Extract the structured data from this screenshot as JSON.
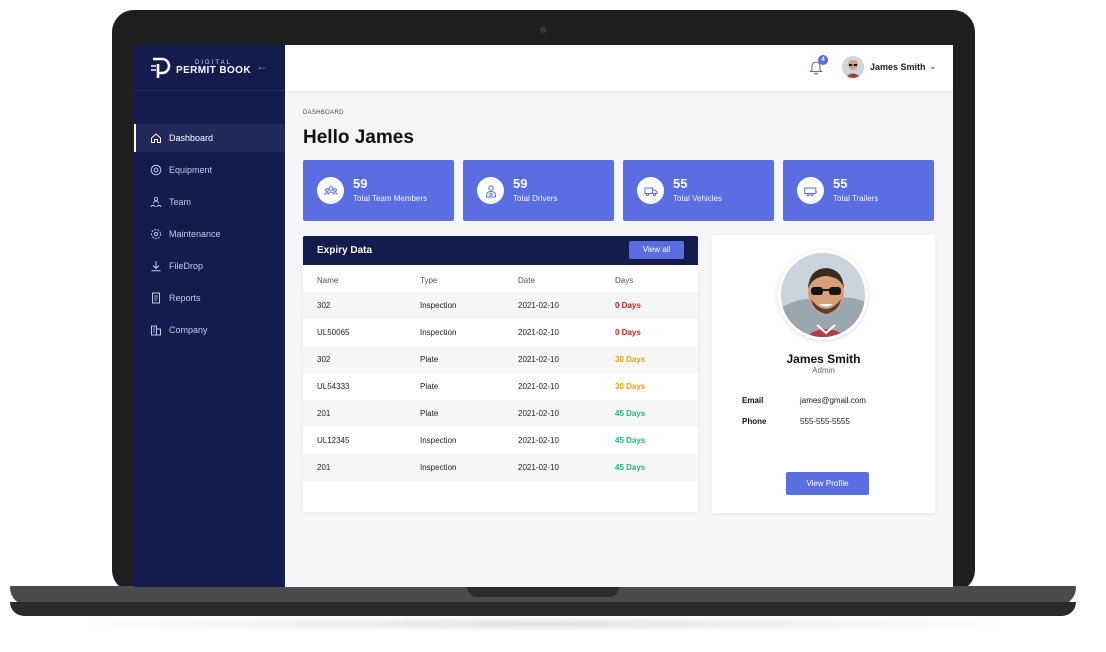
{
  "colors": {
    "sidebar_bg": "#141b4d",
    "accent": "#5b6ee1",
    "days_red": "#d71f1f",
    "days_orange": "#f0a30a",
    "days_green": "#22b97a"
  },
  "sidebar": {
    "logo": {
      "top": "DIGITAL",
      "main": "PERMIT BOOK"
    },
    "collapse_icon": "arrow-left-icon",
    "items": [
      {
        "label": "Dashboard",
        "icon": "home-icon",
        "active": true
      },
      {
        "label": "Equipment",
        "icon": "gear-circle-icon",
        "active": false
      },
      {
        "label": "Team",
        "icon": "team-icon",
        "active": false
      },
      {
        "label": "Maintenance",
        "icon": "maintenance-icon",
        "active": false
      },
      {
        "label": "FileDrop",
        "icon": "download-icon",
        "active": false
      },
      {
        "label": "Reports",
        "icon": "report-icon",
        "active": false
      },
      {
        "label": "Company",
        "icon": "building-icon",
        "active": false
      }
    ]
  },
  "topbar": {
    "notification_count": "4",
    "user_name": "James Smith",
    "chevron": "⌄"
  },
  "main": {
    "breadcrumb": "DASHBOARD",
    "greeting": "Hello James",
    "stats": [
      {
        "value": "59",
        "label": "Total Team Members",
        "icon": "team-icon"
      },
      {
        "value": "59",
        "label": "Total Drivers",
        "icon": "driver-icon"
      },
      {
        "value": "55",
        "label": "Total Vehicles",
        "icon": "truck-icon"
      },
      {
        "value": "55",
        "label": "Total Trailers",
        "icon": "trailer-icon"
      }
    ],
    "expiry": {
      "title": "Expiry Data",
      "view_all": "View all",
      "columns": [
        "Name",
        "Type",
        "Date",
        "Days"
      ],
      "rows": [
        {
          "name": "302",
          "type": "Inspection",
          "date": "2021-02-10",
          "days": "0 Days",
          "status": "red"
        },
        {
          "name": "UL50065",
          "type": "Inspection",
          "date": "2021-02-10",
          "days": "0 Days",
          "status": "red"
        },
        {
          "name": "302",
          "type": "Plate",
          "date": "2021-02-10",
          "days": "30 Days",
          "status": "orange"
        },
        {
          "name": "UL54333",
          "type": "Plate",
          "date": "2021-02-10",
          "days": "30 Days",
          "status": "orange"
        },
        {
          "name": "201",
          "type": "Plate",
          "date": "2021-02-10",
          "days": "45 Days",
          "status": "green"
        },
        {
          "name": "UL12345",
          "type": "Inspection",
          "date": "2021-02-10",
          "days": "45 Days",
          "status": "green"
        },
        {
          "name": "201",
          "type": "Inspection",
          "date": "2021-02-10",
          "days": "45 Days",
          "status": "green"
        }
      ]
    },
    "profile": {
      "name": "James Smith",
      "role": "Admin",
      "email_label": "Email",
      "email": "james@gmail.com",
      "phone_label": "Phone",
      "phone": "555-555-5555",
      "view_profile": "View Profile"
    }
  }
}
